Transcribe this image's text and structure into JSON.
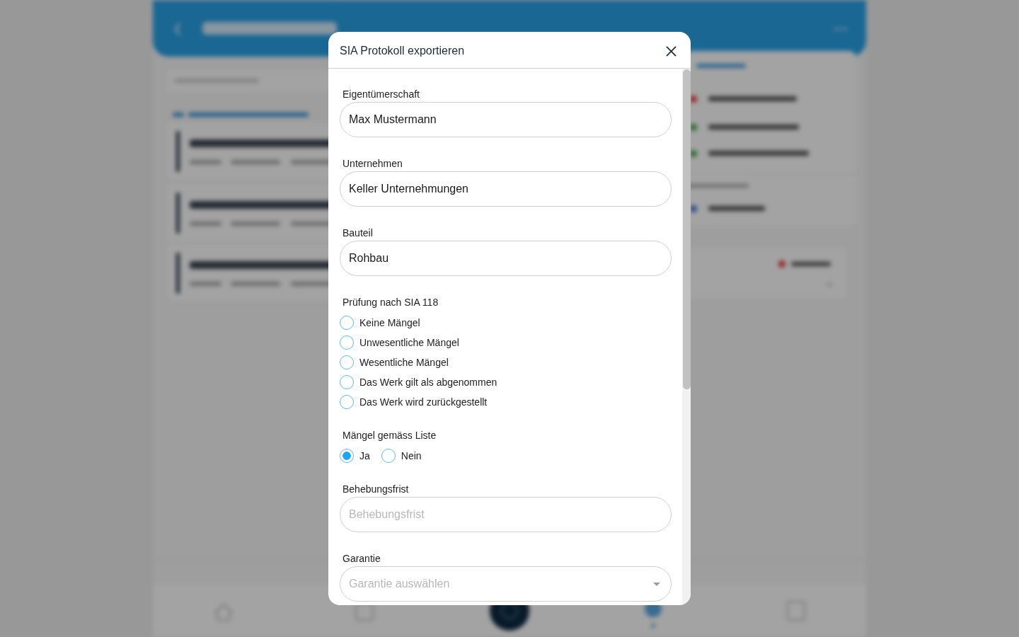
{
  "dialog": {
    "title": "SIA Protokoll exportieren",
    "fields": [
      {
        "kind": "text",
        "label": "Eigentümerschaft",
        "value": "Max Mustermann"
      },
      {
        "kind": "text",
        "label": "Unternehmen",
        "value": "Keller Unternehmungen"
      },
      {
        "kind": "text",
        "label": "Bauteil",
        "value": "Rohbau"
      },
      {
        "kind": "radio-list",
        "label": "Prüfung nach SIA 118",
        "options": [
          {
            "label": "Keine Mängel",
            "selected": false
          },
          {
            "label": "Unwesentliche Mängel",
            "selected": false
          },
          {
            "label": "Wesentliche Mängel",
            "selected": false
          },
          {
            "label": "Das Werk gilt als abgenommen",
            "selected": false
          },
          {
            "label": "Das Werk wird zurückgestellt",
            "selected": false
          }
        ]
      },
      {
        "kind": "radio-inline",
        "label": "Mängel gemäss Liste",
        "options": [
          {
            "label": "Ja",
            "selected": true
          },
          {
            "label": "Nein",
            "selected": false
          }
        ]
      },
      {
        "kind": "text",
        "label": "Behebungsfrist",
        "placeholder": "Behebungsfrist"
      },
      {
        "kind": "select",
        "label": "Garantie",
        "placeholder": "Garantie auswählen"
      }
    ]
  }
}
